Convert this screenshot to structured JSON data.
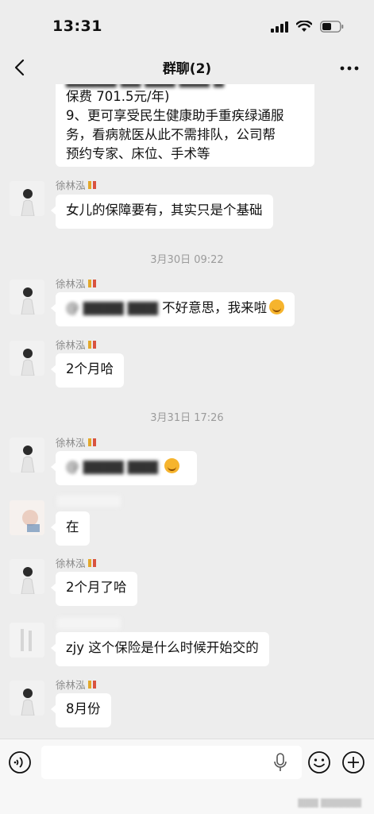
{
  "status_bar": {
    "time": "13:31"
  },
  "nav": {
    "title": "群聊(2)"
  },
  "messages": {
    "m0": {
      "line0": "保费 701.5元/年)",
      "line1": "9、更可享受民生健康助手重疾绿通服",
      "line2": "务，看病就医从此不需排队，公司帮",
      "line3": "预约专家、床位、手术等"
    },
    "m1": {
      "sender": "徐林泓",
      "text": "女儿的保障要有，其实只是个基础"
    },
    "t1": "3月30日 09:22",
    "m2": {
      "sender": "徐林泓",
      "text": "不好意思，我来啦"
    },
    "m3": {
      "sender": "徐林泓",
      "text": "2个月哈"
    },
    "t2": "3月31日 17:26",
    "m4": {
      "sender": "徐林泓"
    },
    "m5": {
      "text": "在"
    },
    "m6": {
      "sender": "徐林泓",
      "text": "2个月了哈"
    },
    "m7": {
      "text": "zjy 这个保险是什么时候开始交的"
    },
    "m8": {
      "sender": "徐林泓",
      "text": "8月份"
    }
  },
  "colors": {
    "background": "#ededed",
    "bubble": "#ffffff",
    "timestamp": "#9b9b9b"
  }
}
